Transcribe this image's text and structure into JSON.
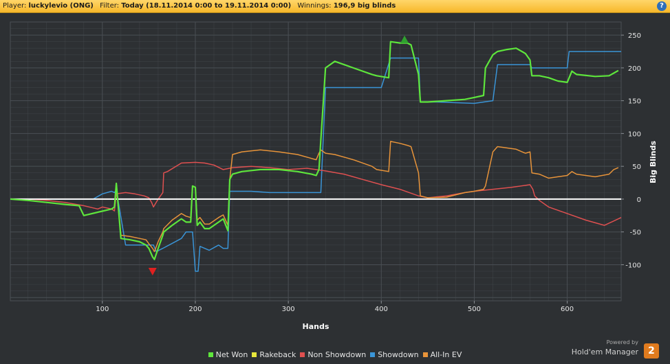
{
  "header": {
    "player_label": "Player:",
    "player_value": "luckylevio (ONG)",
    "filter_label": "Filter:",
    "filter_value": "Today (18.11.2014 0:00 to 19.11.2014 0:00)",
    "winnings_label": "Winnings:",
    "winnings_value": "196,9 big blinds",
    "help_glyph": "?"
  },
  "colors": {
    "background": "#2d3033",
    "grid": "#4a4f54",
    "zero_line": "#ffffff",
    "net_won": "#5ee63c",
    "rakeback": "#e6e63c",
    "non_showdown": "#e05050",
    "showdown": "#3a95d8",
    "allin_ev": "#e8943a"
  },
  "chart_data": {
    "type": "line",
    "xlabel": "Hands",
    "ylabel": "Big Blinds",
    "xlim": [
      1,
      658
    ],
    "ylim": [
      -155,
      270
    ],
    "x_ticks": [
      100,
      200,
      300,
      400,
      500,
      600
    ],
    "y_ticks": [
      -100,
      -50,
      0,
      50,
      100,
      150,
      200,
      250
    ],
    "grid": true,
    "legend_position": "bottom",
    "markers": [
      {
        "name": "max",
        "x": 425,
        "y": 243,
        "shape": "triangle-up",
        "color": "#2fa12f"
      },
      {
        "name": "min",
        "x": 154,
        "y": -110,
        "shape": "triangle-down",
        "color": "#e02020"
      }
    ],
    "series": [
      {
        "name": "Net Won",
        "key": "net_won",
        "x": [
          1,
          20,
          40,
          60,
          75,
          80,
          95,
          110,
          113,
          115,
          120,
          130,
          140,
          147,
          150,
          154,
          156,
          160,
          165,
          166,
          175,
          185,
          190,
          195,
          197,
          200,
          202,
          205,
          210,
          215,
          225,
          230,
          235,
          237,
          240,
          250,
          270,
          290,
          310,
          325,
          330,
          333,
          335,
          340,
          350,
          370,
          390,
          395,
          408,
          410,
          420,
          428,
          432,
          440,
          442,
          450,
          470,
          490,
          500,
          510,
          512,
          520,
          525,
          535,
          545,
          555,
          560,
          562,
          570,
          580,
          590,
          600,
          605,
          610,
          630,
          645,
          650,
          655
        ],
        "y": [
          0,
          -2,
          -5,
          -8,
          -10,
          -25,
          -20,
          -15,
          -12,
          24,
          -60,
          -62,
          -65,
          -70,
          -75,
          -88,
          -92,
          -75,
          -55,
          -50,
          -40,
          -30,
          -35,
          -35,
          20,
          18,
          -40,
          -35,
          -45,
          -45,
          -35,
          -30,
          -48,
          30,
          38,
          42,
          45,
          45,
          42,
          38,
          36,
          45,
          90,
          200,
          210,
          200,
          190,
          188,
          185,
          240,
          238,
          238,
          235,
          190,
          148,
          148,
          150,
          152,
          155,
          158,
          200,
          220,
          225,
          228,
          230,
          222,
          212,
          188,
          188,
          185,
          180,
          178,
          195,
          190,
          187,
          188,
          192,
          196
        ]
      },
      {
        "name": "Rakeback",
        "key": "rakeback",
        "x": [
          1,
          658
        ],
        "y": [
          0,
          0
        ]
      },
      {
        "name": "Non Showdown",
        "key": "non_showdown",
        "x": [
          1,
          20,
          40,
          60,
          80,
          95,
          100,
          110,
          113,
          115,
          125,
          135,
          145,
          150,
          153,
          155,
          160,
          165,
          166,
          170,
          185,
          200,
          210,
          220,
          230,
          240,
          260,
          280,
          300,
          320,
          340,
          360,
          380,
          400,
          420,
          440,
          450,
          470,
          490,
          500,
          520,
          540,
          560,
          563,
          565,
          570,
          580,
          600,
          620,
          640,
          658
        ],
        "y": [
          0,
          0,
          -2,
          -5,
          -10,
          -15,
          -12,
          -15,
          -18,
          8,
          10,
          8,
          5,
          2,
          -5,
          -12,
          0,
          10,
          40,
          42,
          55,
          56,
          55,
          52,
          45,
          48,
          50,
          48,
          45,
          47,
          43,
          38,
          30,
          22,
          15,
          5,
          2,
          5,
          10,
          12,
          15,
          18,
          22,
          15,
          5,
          -2,
          -12,
          -22,
          -32,
          -40,
          -28
        ]
      },
      {
        "name": "Showdown",
        "key": "showdown",
        "x": [
          1,
          90,
          100,
          110,
          113,
          115,
          125,
          135,
          145,
          150,
          155,
          158,
          165,
          185,
          190,
          195,
          197,
          200,
          203,
          205,
          215,
          225,
          230,
          235,
          237,
          260,
          280,
          310,
          330,
          333,
          335,
          340,
          400,
          410,
          430,
          440,
          442,
          460,
          480,
          500,
          520,
          525,
          545,
          560,
          562,
          580,
          600,
          602,
          620,
          640,
          658
        ],
        "y": [
          0,
          0,
          8,
          12,
          10,
          14,
          -70,
          -70,
          -70,
          -70,
          -70,
          -80,
          -75,
          -60,
          -50,
          -50,
          -50,
          -110,
          -110,
          -72,
          -78,
          -70,
          -75,
          -75,
          12,
          12,
          10,
          10,
          10,
          10,
          10,
          170,
          170,
          215,
          215,
          215,
          148,
          148,
          147,
          146,
          150,
          205,
          205,
          205,
          200,
          200,
          200,
          225,
          225,
          225,
          225
        ]
      },
      {
        "name": "All-In EV",
        "key": "allin_ev",
        "x": [
          1,
          20,
          40,
          60,
          75,
          80,
          95,
          110,
          113,
          115,
          120,
          130,
          140,
          147,
          150,
          154,
          156,
          160,
          165,
          166,
          175,
          185,
          190,
          195,
          197,
          200,
          202,
          205,
          210,
          215,
          225,
          230,
          235,
          237,
          240,
          250,
          270,
          290,
          310,
          325,
          330,
          333,
          335,
          340,
          350,
          370,
          390,
          395,
          408,
          410,
          420,
          428,
          432,
          440,
          442,
          450,
          470,
          490,
          500,
          510,
          512,
          520,
          525,
          535,
          545,
          555,
          560,
          562,
          570,
          580,
          590,
          600,
          605,
          610,
          630,
          645,
          650,
          655
        ],
        "y": [
          0,
          -2,
          -5,
          -8,
          -10,
          -25,
          -20,
          -15,
          -12,
          24,
          -55,
          -57,
          -60,
          -62,
          -68,
          -75,
          -80,
          -65,
          -50,
          -45,
          -32,
          -22,
          -26,
          -28,
          20,
          18,
          -32,
          -28,
          -38,
          -38,
          -28,
          -24,
          -40,
          30,
          68,
          72,
          75,
          72,
          68,
          62,
          60,
          70,
          75,
          70,
          68,
          60,
          50,
          45,
          42,
          88,
          85,
          82,
          80,
          40,
          5,
          2,
          3,
          10,
          12,
          15,
          20,
          72,
          80,
          78,
          76,
          70,
          72,
          40,
          38,
          32,
          34,
          36,
          42,
          38,
          34,
          38,
          45,
          48
        ]
      }
    ]
  },
  "legend": [
    {
      "label": "Net Won",
      "key": "net_won"
    },
    {
      "label": "Rakeback",
      "key": "rakeback"
    },
    {
      "label": "Non Showdown",
      "key": "non_showdown"
    },
    {
      "label": "Showdown",
      "key": "showdown"
    },
    {
      "label": "All-In EV",
      "key": "allin_ev"
    }
  ],
  "branding": {
    "powered_by": "Powered by",
    "product": "Hold'em Manager",
    "logo_glyph": "2"
  }
}
